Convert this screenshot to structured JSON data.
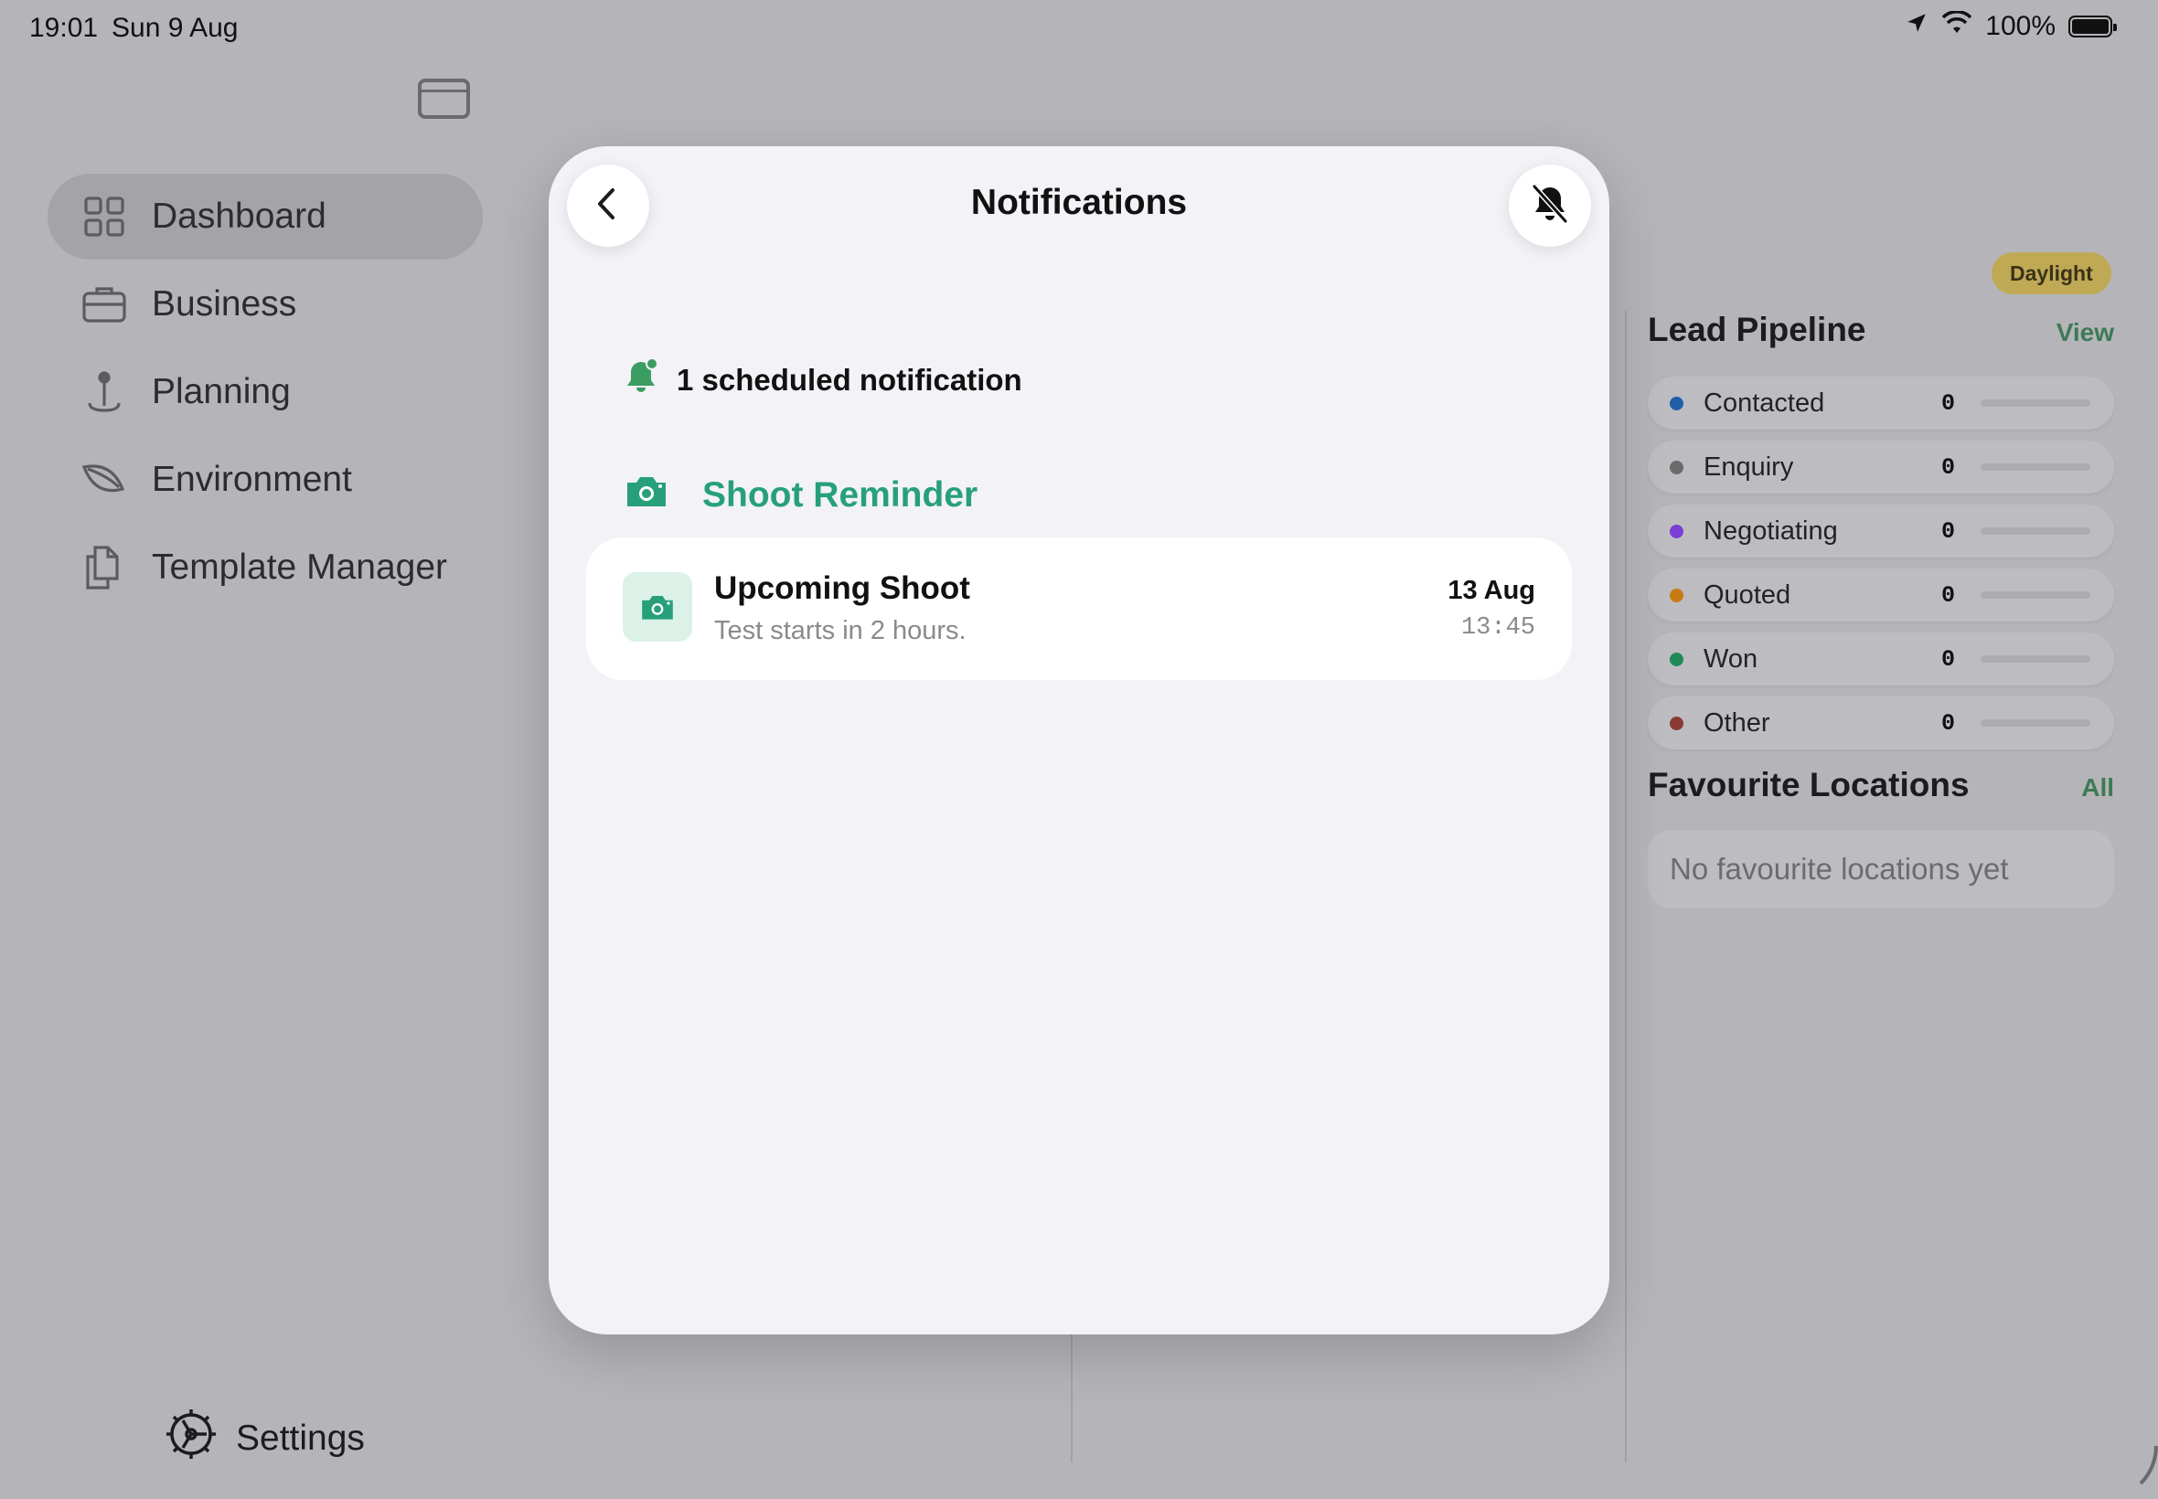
{
  "status_bar": {
    "time": "19:01",
    "date": "Sun 9 Aug",
    "battery": "100%",
    "icons": [
      "location-arrow-icon",
      "wifi-icon",
      "battery-icon"
    ]
  },
  "sidebar": {
    "items": [
      {
        "label": "Dashboard",
        "icon": "grid-icon",
        "active": true
      },
      {
        "label": "Business",
        "icon": "briefcase-icon",
        "active": false
      },
      {
        "label": "Planning",
        "icon": "map-pin-icon",
        "active": false
      },
      {
        "label": "Environment",
        "icon": "leaf-icon",
        "active": false
      },
      {
        "label": "Template Manager",
        "icon": "documents-icon",
        "active": false
      }
    ],
    "settings_label": "Settings"
  },
  "right_panel": {
    "badge": "Daylight",
    "pipeline": {
      "title": "Lead Pipeline",
      "link": "View",
      "rows": [
        {
          "label": "Contacted",
          "count": "0",
          "color": "#1f5fa8"
        },
        {
          "label": "Enquiry",
          "count": "0",
          "color": "#6b6b6b"
        },
        {
          "label": "Negotiating",
          "count": "0",
          "color": "#7b3fd6"
        },
        {
          "label": "Quoted",
          "count": "0",
          "color": "#c87a14"
        },
        {
          "label": "Won",
          "count": "0",
          "color": "#1f8a5a"
        },
        {
          "label": "Other",
          "count": "0",
          "color": "#8a3a32"
        }
      ]
    },
    "favourites": {
      "title": "Favourite Locations",
      "link": "All",
      "empty": "No favourite locations yet"
    }
  },
  "modal": {
    "title": "Notifications",
    "summary": "1 scheduled notification",
    "group": {
      "title": "Shoot Reminder",
      "accent": "#27a07a",
      "items": [
        {
          "title": "Upcoming Shoot",
          "body": "Test starts in 2 hours.",
          "date": "13 Aug",
          "time": "13:45"
        }
      ]
    }
  }
}
